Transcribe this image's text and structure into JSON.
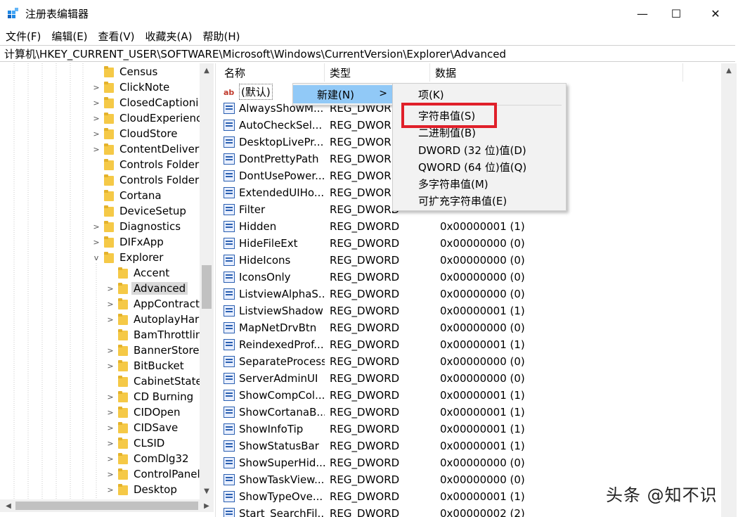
{
  "window": {
    "title": "注册表编辑器",
    "minimize_glyph": "—",
    "maximize_glyph": "☐",
    "close_glyph": "✕"
  },
  "menu": [
    "文件(F)",
    "编辑(E)",
    "查看(V)",
    "收藏夹(A)",
    "帮助(H)"
  ],
  "address": "计算机\\HKEY_CURRENT_USER\\SOFTWARE\\Microsoft\\Windows\\CurrentVersion\\Explorer\\Advanced",
  "tree": {
    "items": [
      {
        "label": "Census",
        "expand": ""
      },
      {
        "label": "ClickNote",
        "expand": ">"
      },
      {
        "label": "ClosedCaptioni",
        "expand": ">"
      },
      {
        "label": "CloudExperienc",
        "expand": ">"
      },
      {
        "label": "CloudStore",
        "expand": ">"
      },
      {
        "label": "ContentDelivery",
        "expand": ">"
      },
      {
        "label": "Controls Folder",
        "expand": ""
      },
      {
        "label": "Controls Folder",
        "expand": ""
      },
      {
        "label": "Cortana",
        "expand": ""
      },
      {
        "label": "DeviceSetup",
        "expand": ""
      },
      {
        "label": "Diagnostics",
        "expand": ">"
      },
      {
        "label": "DIFxApp",
        "expand": ">"
      },
      {
        "label": "Explorer",
        "expand": "v"
      },
      {
        "label": "Accent",
        "expand": ""
      },
      {
        "label": "Advanced",
        "expand": ">"
      },
      {
        "label": "AppContract",
        "expand": ">"
      },
      {
        "label": "AutoplayHar",
        "expand": ">"
      },
      {
        "label": "BamThrottlin",
        "expand": ""
      },
      {
        "label": "BannerStore",
        "expand": ">"
      },
      {
        "label": "BitBucket",
        "expand": ">"
      },
      {
        "label": "CabinetState",
        "expand": ""
      },
      {
        "label": "CD Burning",
        "expand": ">"
      },
      {
        "label": "CIDOpen",
        "expand": ">"
      },
      {
        "label": "CIDSave",
        "expand": ">"
      },
      {
        "label": "CLSID",
        "expand": ">"
      },
      {
        "label": "ComDlg32",
        "expand": ">"
      },
      {
        "label": "ControlPanel",
        "expand": ">"
      },
      {
        "label": "Desktop",
        "expand": ">"
      }
    ]
  },
  "list": {
    "headers": {
      "name": "名称",
      "type": "类型",
      "data": "数据"
    },
    "default_name": "(默认)",
    "rows": [
      {
        "name": "AlwaysShowM...",
        "type": "REG_DWORD",
        "data": ""
      },
      {
        "name": "AutoCheckSel...",
        "type": "REG_DWORD",
        "data": ""
      },
      {
        "name": "DesktopLivePr...",
        "type": "REG_DWORD",
        "data": ""
      },
      {
        "name": "DontPrettyPath",
        "type": "REG_DWORD",
        "data": ""
      },
      {
        "name": "DontUsePower...",
        "type": "REG_DWORD",
        "data": ""
      },
      {
        "name": "ExtendedUIHo...",
        "type": "REG_DWORD",
        "data": ""
      },
      {
        "name": "Filter",
        "type": "REG_DWORD",
        "data": ""
      },
      {
        "name": "Hidden",
        "type": "REG_DWORD",
        "data": "0x00000001 (1)"
      },
      {
        "name": "HideFileExt",
        "type": "REG_DWORD",
        "data": "0x00000000 (0)"
      },
      {
        "name": "HideIcons",
        "type": "REG_DWORD",
        "data": "0x00000000 (0)"
      },
      {
        "name": "IconsOnly",
        "type": "REG_DWORD",
        "data": "0x00000000 (0)"
      },
      {
        "name": "ListviewAlphaS...",
        "type": "REG_DWORD",
        "data": "0x00000000 (0)"
      },
      {
        "name": "ListviewShadow",
        "type": "REG_DWORD",
        "data": "0x00000001 (1)"
      },
      {
        "name": "MapNetDrvBtn",
        "type": "REG_DWORD",
        "data": "0x00000000 (0)"
      },
      {
        "name": "ReindexedProf...",
        "type": "REG_DWORD",
        "data": "0x00000001 (1)"
      },
      {
        "name": "SeparateProcess",
        "type": "REG_DWORD",
        "data": "0x00000000 (0)"
      },
      {
        "name": "ServerAdminUI",
        "type": "REG_DWORD",
        "data": "0x00000000 (0)"
      },
      {
        "name": "ShowCompCol...",
        "type": "REG_DWORD",
        "data": "0x00000001 (1)"
      },
      {
        "name": "ShowCortanaB...",
        "type": "REG_DWORD",
        "data": "0x00000001 (1)"
      },
      {
        "name": "ShowInfoTip",
        "type": "REG_DWORD",
        "data": "0x00000001 (1)"
      },
      {
        "name": "ShowStatusBar",
        "type": "REG_DWORD",
        "data": "0x00000001 (1)"
      },
      {
        "name": "ShowSuperHid...",
        "type": "REG_DWORD",
        "data": "0x00000000 (0)"
      },
      {
        "name": "ShowTaskView...",
        "type": "REG_DWORD",
        "data": "0x00000000 (0)"
      },
      {
        "name": "ShowTypeOve...",
        "type": "REG_DWORD",
        "data": "0x00000001 (1)"
      },
      {
        "name": "Start_SearchFil...",
        "type": "REG_DWORD",
        "data": "0x00000002 (2)"
      }
    ]
  },
  "context_menu": {
    "new_label": "新建(N)",
    "new_arrow": ">",
    "submenu": [
      "项(K)",
      "字符串值(S)",
      "二进制值(B)",
      "DWORD (32 位)值(D)",
      "QWORD (64 位)值(Q)",
      "多字符串值(M)",
      "可扩充字符串值(E)"
    ]
  },
  "watermark": "头条 @知不识",
  "colors": {
    "highlight_box": "#e0202a",
    "menu_hover": "#91c9f7",
    "folder": "#f5c947"
  }
}
